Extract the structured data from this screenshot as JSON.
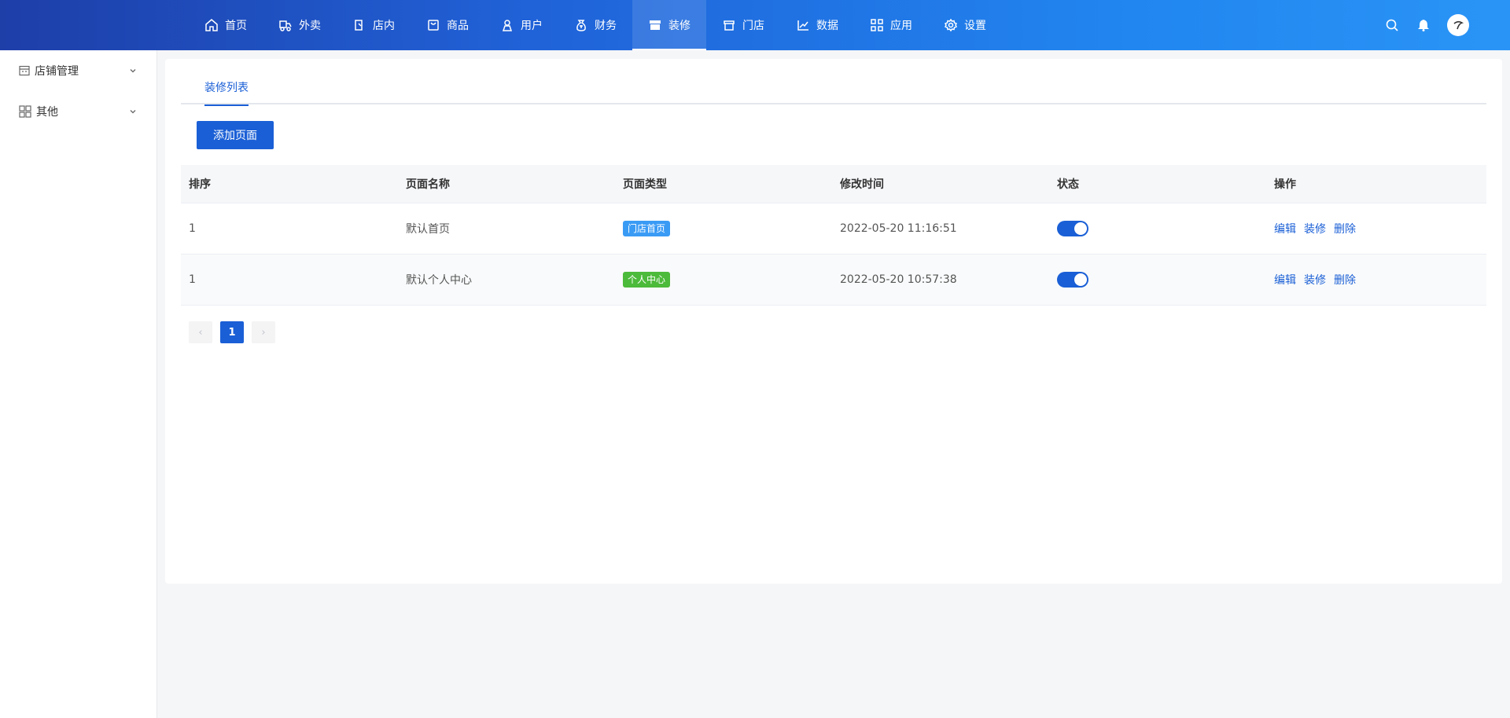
{
  "nav": [
    {
      "label": "首页",
      "icon": "home-icon"
    },
    {
      "label": "外卖",
      "icon": "takeout-icon"
    },
    {
      "label": "店内",
      "icon": "dine-in-icon"
    },
    {
      "label": "商品",
      "icon": "product-icon"
    },
    {
      "label": "用户",
      "icon": "user-icon"
    },
    {
      "label": "财务",
      "icon": "finance-icon"
    },
    {
      "label": "装修",
      "icon": "decorate-icon",
      "active": true
    },
    {
      "label": "门店",
      "icon": "store-icon"
    },
    {
      "label": "数据",
      "icon": "chart-icon"
    },
    {
      "label": "应用",
      "icon": "apps-icon"
    },
    {
      "label": "设置",
      "icon": "gear-icon"
    }
  ],
  "sidebar": {
    "items": [
      {
        "label": "店铺管理",
        "icon": "shop-icon"
      },
      {
        "label": "其他",
        "icon": "grid-icon"
      }
    ]
  },
  "tabs": {
    "active": "装修列表"
  },
  "toolbar": {
    "add_label": "添加页面"
  },
  "table": {
    "headers": [
      "排序",
      "页面名称",
      "页面类型",
      "修改时间",
      "状态",
      "操作"
    ],
    "rows": [
      {
        "sort": "1",
        "name": "默认首页",
        "type": "门店首页",
        "type_color": "#3a9bf5",
        "time": "2022-05-20 11:16:51",
        "enabled": true
      },
      {
        "sort": "1",
        "name": "默认个人中心",
        "type": "个人中心",
        "type_color": "#4cba3a",
        "time": "2022-05-20 10:57:38",
        "enabled": true
      }
    ],
    "actions": [
      "编辑",
      "装修",
      "删除"
    ]
  },
  "pager": {
    "prev": "‹",
    "current": "1",
    "next": "›"
  },
  "colors": {
    "primary": "#1a5fd6",
    "nav_start": "#1e3ea8",
    "nav_end": "#2a94f6"
  }
}
